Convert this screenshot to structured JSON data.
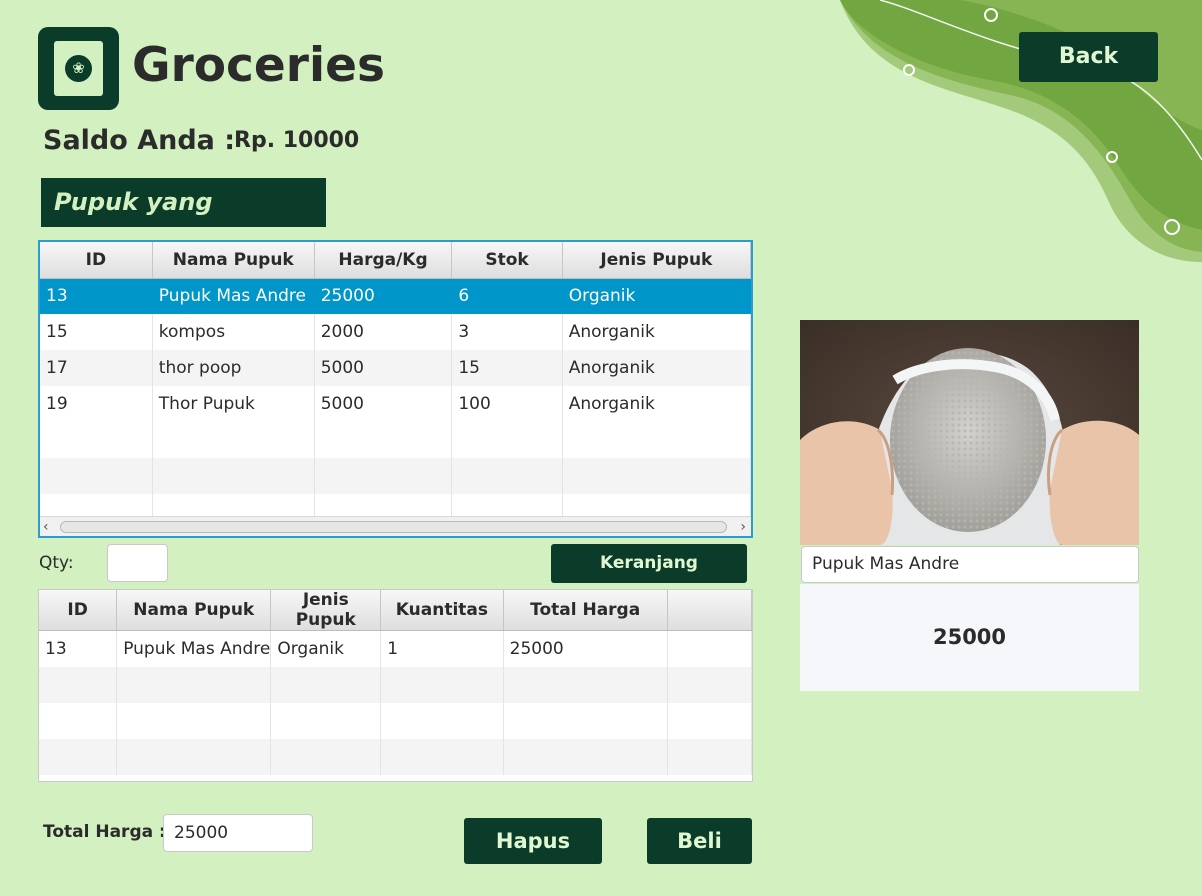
{
  "app": {
    "title": "Groceries",
    "logo_icon": "leaf-icon"
  },
  "header": {
    "back_label": "Back"
  },
  "balance": {
    "label": "Saldo Anda :",
    "value": "Rp. 10000"
  },
  "available": {
    "heading": "Pupuk yang tersedia :",
    "columns": [
      "ID",
      "Nama Pupuk",
      "Harga/Kg",
      "Stok",
      "Jenis Pupuk"
    ],
    "rows": [
      [
        "13",
        "Pupuk Mas Andre",
        "25000",
        "6",
        "Organik"
      ],
      [
        "15",
        "kompos",
        "2000",
        "3",
        "Anorganik"
      ],
      [
        "17",
        "thor poop",
        "5000",
        "15",
        "Anorganik"
      ],
      [
        "19",
        "Thor Pupuk",
        "5000",
        "100",
        "Anorganik"
      ]
    ],
    "selected_row": 0
  },
  "order": {
    "qty_label": "Qty:",
    "qty_value": "",
    "cart_button": "Keranjang"
  },
  "cart": {
    "columns": [
      "ID",
      "Nama Pupuk",
      "Jenis Pupuk",
      "Kuantitas",
      "Total Harga"
    ],
    "rows": [
      [
        "13",
        "Pupuk Mas Andre",
        "Organik",
        "1",
        "25000"
      ]
    ]
  },
  "footer": {
    "total_label": "Total Harga :",
    "total_value": "25000",
    "delete_button": "Hapus",
    "buy_button": "Beli"
  },
  "detail": {
    "image_subject": "hands holding sack of fertilizer granules",
    "name": "Pupuk Mas Andre",
    "price": "25000"
  },
  "colors": {
    "background": "#d2f0c0",
    "dark_green": "#0b3b29",
    "selection_blue": "#0096c9",
    "leaf_green": "#7fb04a"
  }
}
